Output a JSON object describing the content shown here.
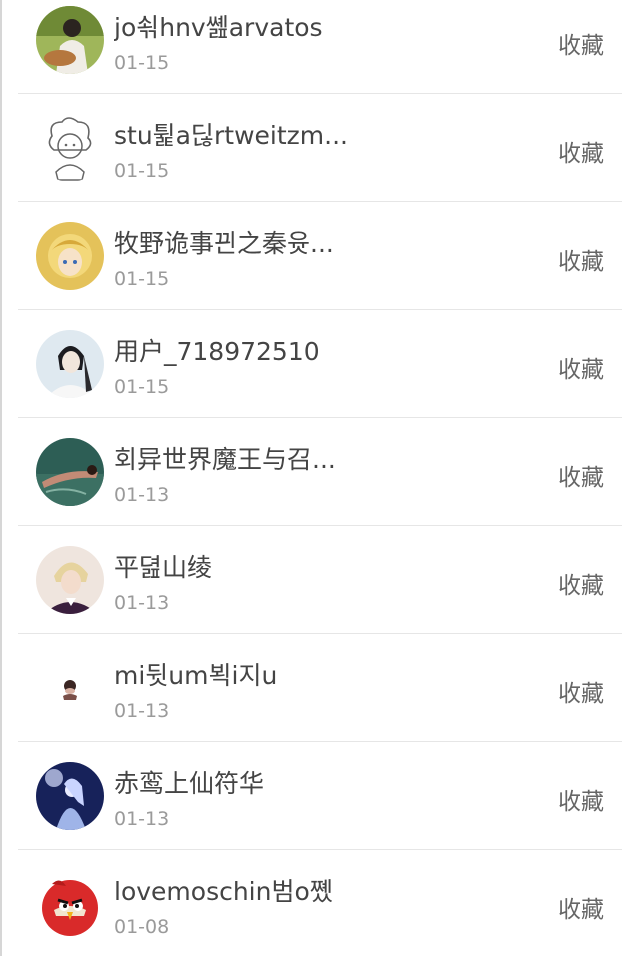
{
  "feed": {
    "items": [
      {
        "name": "jo쇢hnv쏊arvatos",
        "date": "01-15",
        "action": "收藏",
        "avatar": "avatar-guitar-girl"
      },
      {
        "name": "stu튍a딚rtweitzm...",
        "date": "01-15",
        "action": "收藏",
        "avatar": "avatar-cartoon-sketch"
      },
      {
        "name": "牧野诡事끤之秦윳...",
        "date": "01-15",
        "action": "收藏",
        "avatar": "avatar-anime-blonde"
      },
      {
        "name": "用户_718972510",
        "date": "01-15",
        "action": "收藏",
        "avatar": "avatar-white-robed-man"
      },
      {
        "name": "회异世界魔王与召...",
        "date": "01-13",
        "action": "收藏",
        "avatar": "avatar-lying-figure"
      },
      {
        "name": "平뎚山绫",
        "date": "01-13",
        "action": "收藏",
        "avatar": "avatar-blond-boy"
      },
      {
        "name": "mi뒷um뵉i지u",
        "date": "01-13",
        "action": "收藏",
        "avatar": "avatar-small-figure"
      },
      {
        "name": "赤鸾上仙符华",
        "date": "01-13",
        "action": "收藏",
        "avatar": "avatar-blue-anime"
      },
      {
        "name": "lovemoschin범o쪴",
        "date": "01-08",
        "action": "收藏",
        "avatar": "avatar-red-bird"
      }
    ]
  }
}
